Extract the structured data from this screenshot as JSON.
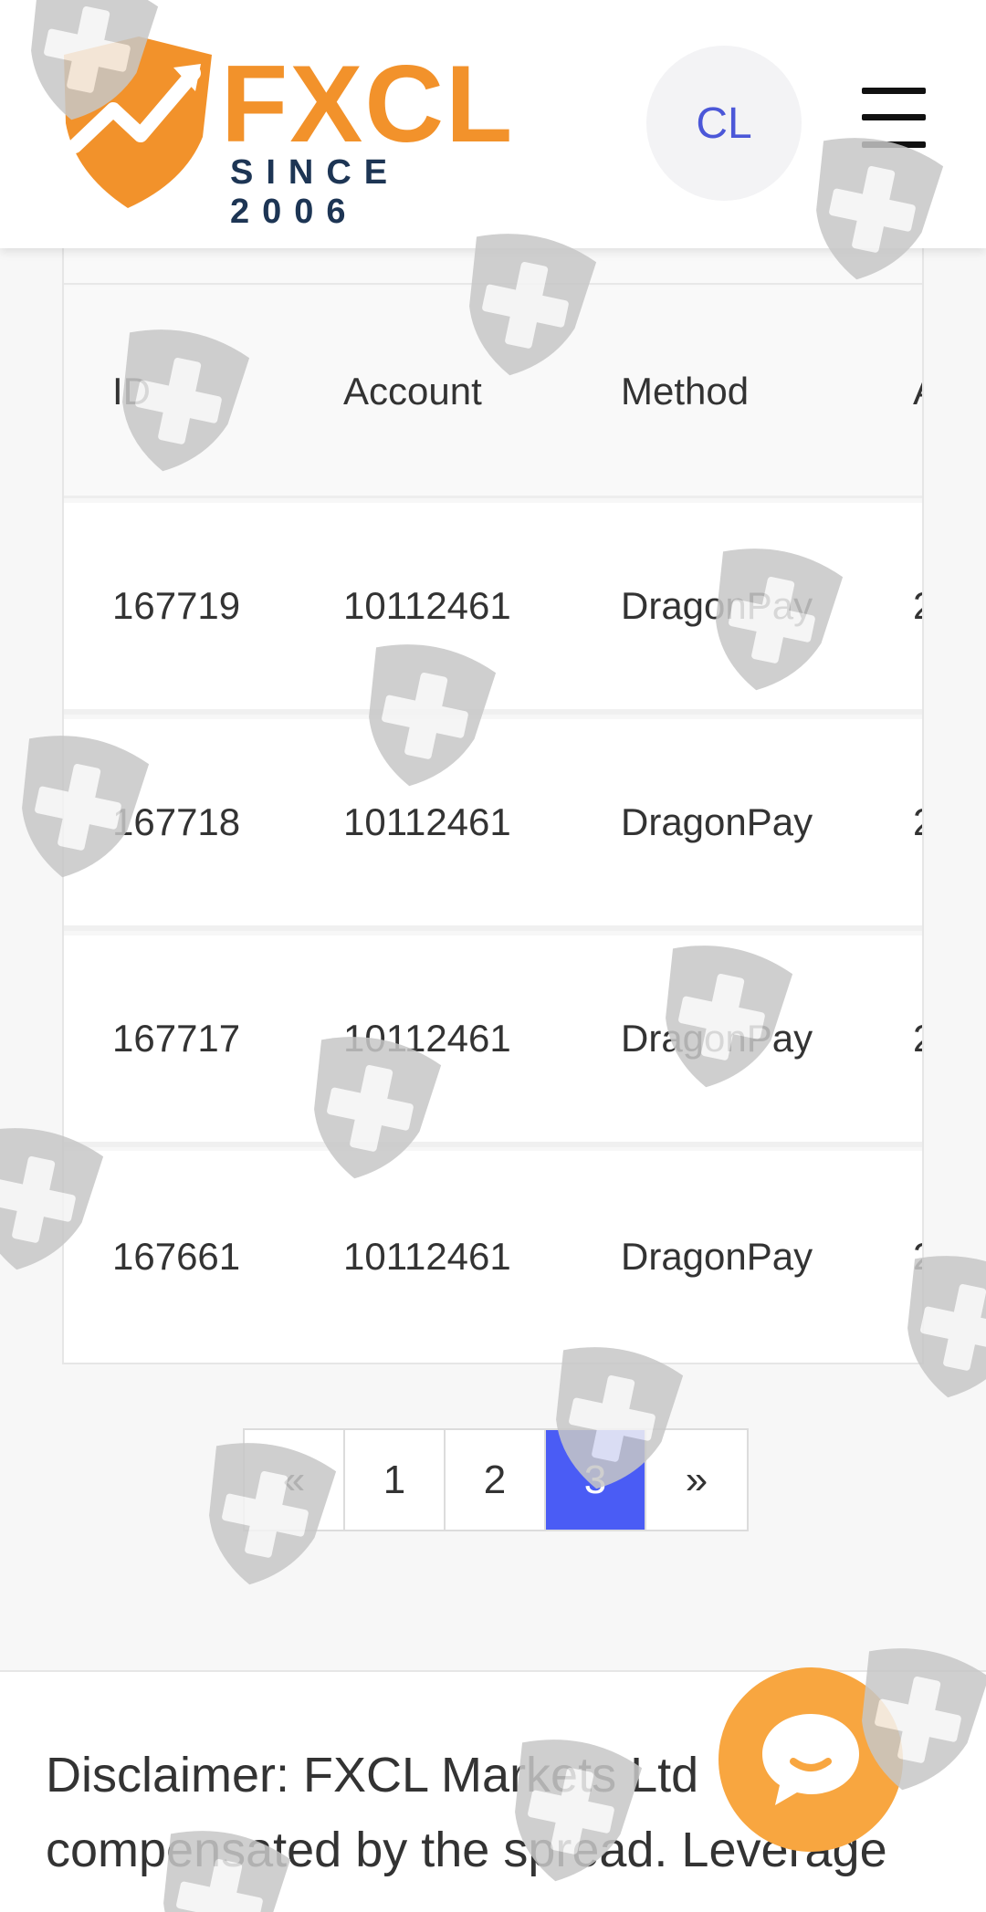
{
  "header": {
    "logo_text": "FXCL",
    "logo_tagline": "SINCE 2006",
    "user_initials": "CL"
  },
  "table": {
    "columns": [
      "ID",
      "Account",
      "Method",
      "A"
    ],
    "rows": [
      {
        "id": "167719",
        "account": "10112461",
        "method": "DragonPay",
        "amount": "2"
      },
      {
        "id": "167718",
        "account": "10112461",
        "method": "DragonPay",
        "amount": "2"
      },
      {
        "id": "167717",
        "account": "10112461",
        "method": "DragonPay",
        "amount": "2"
      },
      {
        "id": "167661",
        "account": "10112461",
        "method": "DragonPay",
        "amount": "2"
      }
    ]
  },
  "pagination": {
    "prev": "«",
    "pages": [
      "1",
      "2",
      "3"
    ],
    "current": "3",
    "next": "»"
  },
  "footer": {
    "disclaimer": "Disclaimer: FXCL Markets Ltd compensated by the spread. Leverage"
  },
  "colors": {
    "brand_orange": "#f2922b",
    "brand_navy": "#1d3554",
    "accent_blue": "#4a5cf5",
    "chat_orange": "#f8a640"
  }
}
